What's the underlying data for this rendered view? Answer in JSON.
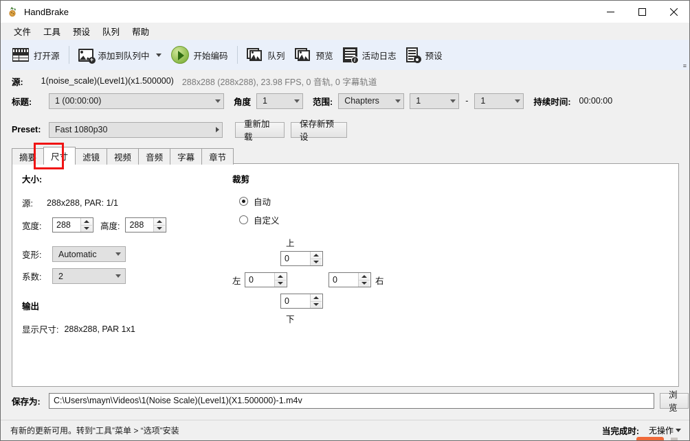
{
  "window": {
    "title": "HandBrake",
    "app_icon": "handbrake-pineapple-icon",
    "minimize_label": "—",
    "maximize_label": "☐",
    "close_label": "✕"
  },
  "menubar": {
    "items": [
      {
        "label": "文件",
        "name": "menu-file"
      },
      {
        "label": "工具",
        "name": "menu-tools"
      },
      {
        "label": "预设",
        "name": "menu-presets"
      },
      {
        "label": "队列",
        "name": "menu-queue"
      },
      {
        "label": "帮助",
        "name": "menu-help"
      }
    ]
  },
  "toolbar": {
    "open_source": "打开源",
    "add_to_queue": "添加到队列中",
    "start_encode": "开始编码",
    "queue": "队列",
    "preview": "预览",
    "activity_log": "活动日志",
    "presets": "预设",
    "overflow": "≡"
  },
  "source": {
    "label": "源:",
    "name": "1(noise_scale)(Level1)(x1.500000)",
    "meta": "288x288 (288x288), 23.98 FPS, 0 音轨, 0 字幕轨道"
  },
  "title_row": {
    "title_label": "标题:",
    "title_value": "1  (00:00:00)",
    "angle_label": "角度",
    "angle_value": "1",
    "range_label": "范围:",
    "range_value": "Chapters",
    "chapter_start": "1",
    "dash": "-",
    "chapter_end": "1",
    "duration_label": "持续时间:",
    "duration_value": "00:00:00"
  },
  "preset_row": {
    "label": "Preset:",
    "value": "Fast 1080p30",
    "reload_button": "重新加载",
    "save_new_preset_button": "保存新预设"
  },
  "tabs": {
    "items": [
      {
        "label": "摘要",
        "name": "tab-summary",
        "active": false
      },
      {
        "label": "尺寸",
        "name": "tab-dimensions",
        "active": true
      },
      {
        "label": "滤镜",
        "name": "tab-filters",
        "active": false
      },
      {
        "label": "视频",
        "name": "tab-video",
        "active": false
      },
      {
        "label": "音频",
        "name": "tab-audio",
        "active": false
      },
      {
        "label": "字幕",
        "name": "tab-subtitles",
        "active": false
      },
      {
        "label": "章节",
        "name": "tab-chapters",
        "active": false
      }
    ],
    "highlight_color": "#f01414"
  },
  "dimensions": {
    "size_heading": "大小:",
    "source_label": "源:",
    "source_value": "288x288, PAR: 1/1",
    "width_label": "宽度:",
    "width_value": "288",
    "height_label": "高度:",
    "height_value": "288",
    "anamorphic_label": "变形:",
    "anamorphic_value": "Automatic",
    "modulus_label": "系数:",
    "modulus_value": "2",
    "output_heading": "输出",
    "display_size_label": "显示尺寸:",
    "display_size_value": "288x288,  PAR 1x1"
  },
  "crop": {
    "heading": "裁剪",
    "auto_label": "自动",
    "auto_selected": true,
    "custom_label": "自定义",
    "custom_selected": false,
    "top_label": "上",
    "top_value": "0",
    "left_label": "左",
    "left_value": "0",
    "right_label": "右",
    "right_value": "0",
    "bottom_label": "下",
    "bottom_value": "0"
  },
  "save_row": {
    "label": "保存为:",
    "path": "C:\\Users\\mayn\\Videos\\1(Noise Scale)(Level1)(X1.500000)-1.m4v",
    "browse_button": "浏览"
  },
  "statusbar": {
    "message": "有新的更新可用。转到“工具”菜单 > “选项”安装",
    "when_done_label": "当完成时:",
    "when_done_value": "无操作"
  }
}
